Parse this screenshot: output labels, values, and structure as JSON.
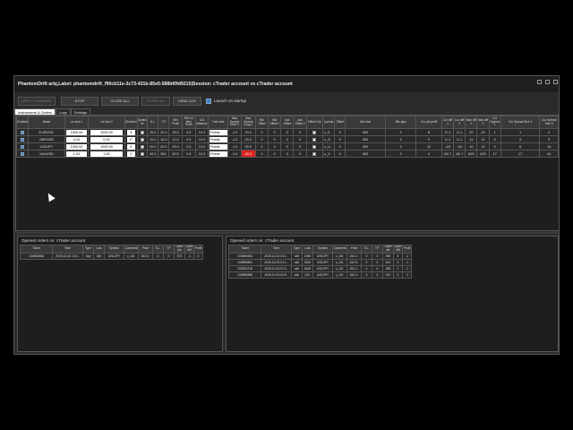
{
  "window": {
    "title": "PhantomDrift arbj,Label: phantomdrift_f90cb11e-3c73-431b-85e5-588bf0fd9215|Session: cTrader account vs cTrader account"
  },
  "toolbar": {
    "apply_label": "APPLY CHANGES",
    "stop_label": "STOP",
    "close_all_label": "CLOSE ALL",
    "close_all2_label": "CLOSE ALL",
    "view_log_label": "VIEW LOG",
    "launch_label": "Launch on startup"
  },
  "tabs": [
    "Instruments & Orders",
    "Logs",
    "Settings"
  ],
  "instruments": {
    "headers": [
      "Enabled",
      "Name",
      "Lot size 1",
      "Lot size 2",
      "Direction",
      "Symbol fix",
      "S.L.",
      "T.P.",
      "Min Profit",
      "Rev lot Max Profit",
      "Cut distance",
      "Trail units",
      "Max Spread Short 1",
      "Max Spread Long 1",
      "Bid Offset",
      "Bid Offset 2",
      "Ask Offset",
      "Ask Offset 2",
      "Offset Cut",
      "Lpoints",
      "Offset",
      "Min time",
      "Min pips",
      "Cur pts profit",
      "Cur diff 1",
      "Cur diff 2",
      "Max diff 1",
      "Max diff 2",
      "Cur Spread 1",
      "Cur Spread Size 2",
      "Cur Spread Size 3"
    ],
    "rows": [
      [
        "EURUSD.",
        "1000.00",
        "1000.00",
        "3",
        "20.0",
        "20.0",
        "25.0",
        "0.0",
        "10.0",
        "Points",
        "-1.0",
        "20.0",
        "0",
        "0",
        "0",
        "0",
        "c_E.",
        "0",
        "500",
        "0",
        "8",
        "2/-1",
        "2/-1",
        "20",
        "20",
        "1",
        "1",
        "4"
      ],
      [
        "GBPUSD",
        "0.10",
        "0.10",
        "0",
        "10.0",
        "10.0",
        "10.0",
        "0.0",
        "10.0",
        "Points",
        "-1.0",
        "20.0",
        "0",
        "0",
        "0",
        "0",
        "c_G.",
        "0",
        "500",
        "0",
        "0",
        "1/-1",
        "1/-1",
        "11",
        "11",
        "0",
        "0",
        "3"
      ],
      [
        "USDJPY",
        "1000.00",
        "1000.00",
        "0",
        "20.0",
        "20.0",
        "25.0",
        "0.0",
        "10.0",
        "Points",
        "-1.0",
        "20.0",
        "0",
        "0",
        "0",
        "0",
        "c_U.",
        "0",
        "500",
        "0",
        "12",
        "-1/0",
        "-1/0",
        "10",
        "10",
        "0",
        "6",
        "16"
      ],
      [
        "XAUUSD",
        "1.00",
        "1.00",
        "2",
        "40.0",
        "300.",
        "50.0",
        "0.0",
        "10.0",
        "Points",
        "-1.0",
        "40.0",
        "0",
        "0",
        "0",
        "0",
        "c_X.",
        "0",
        "500",
        "0",
        "0",
        "40/-7",
        "40/-7",
        "600",
        "620",
        "17",
        "17",
        "24"
      ]
    ]
  },
  "left_pane": {
    "title": "Opened orders on: cTrader account",
    "headers": [
      "Ticket",
      "Time",
      "Type",
      "Lots",
      "Symbol",
      "Comment",
      "Price",
      "S.L.",
      "T.P.",
      "Open pts",
      "Open diff",
      "Profit"
    ],
    "rows": [
      [
        "104805886",
        "2025.10.23 13:4..",
        "buy",
        "340",
        "USDJPY",
        "c_US.",
        "152.5..",
        "0",
        "0",
        "373",
        "-1",
        "0"
      ]
    ]
  },
  "right_pane": {
    "title": "Opened orders on: cTrader account",
    "headers": [
      "Ticket",
      "Time",
      "Type",
      "Lots",
      "Symbol",
      "Comment",
      "Price",
      "S.L.",
      "T.P.",
      "Open pts",
      "Open diff",
      "Profit"
    ],
    "rows": [
      [
        "103894694",
        "2025.10.23 01:1..",
        "sell",
        "1000",
        "USDJPY",
        "c_US.",
        "152.2..",
        "0",
        "0",
        "355",
        "4",
        "-1"
      ],
      [
        "103895881",
        "2025.10.23 01:1..",
        "sell",
        "3000",
        "USDJPY",
        "c_US.",
        "152.5..",
        "0",
        "0",
        "401",
        "0",
        "-1"
      ],
      [
        "103870218",
        "2025.10.23 01:2..",
        "sell",
        "4000",
        "USDJPY",
        "c_US.",
        "152.4..",
        "0",
        "0",
        "396",
        "1",
        "-1"
      ],
      [
        "103896888",
        "2025.10.23 02:5..",
        "sell",
        "220.",
        "USDJPY",
        "c_US.",
        "152.4..",
        "0",
        "0",
        "337",
        "0",
        "-1"
      ]
    ]
  },
  "colors": {
    "accent": "#3a7bd5",
    "alert": "#e02020",
    "background": "#2b2b2b"
  }
}
